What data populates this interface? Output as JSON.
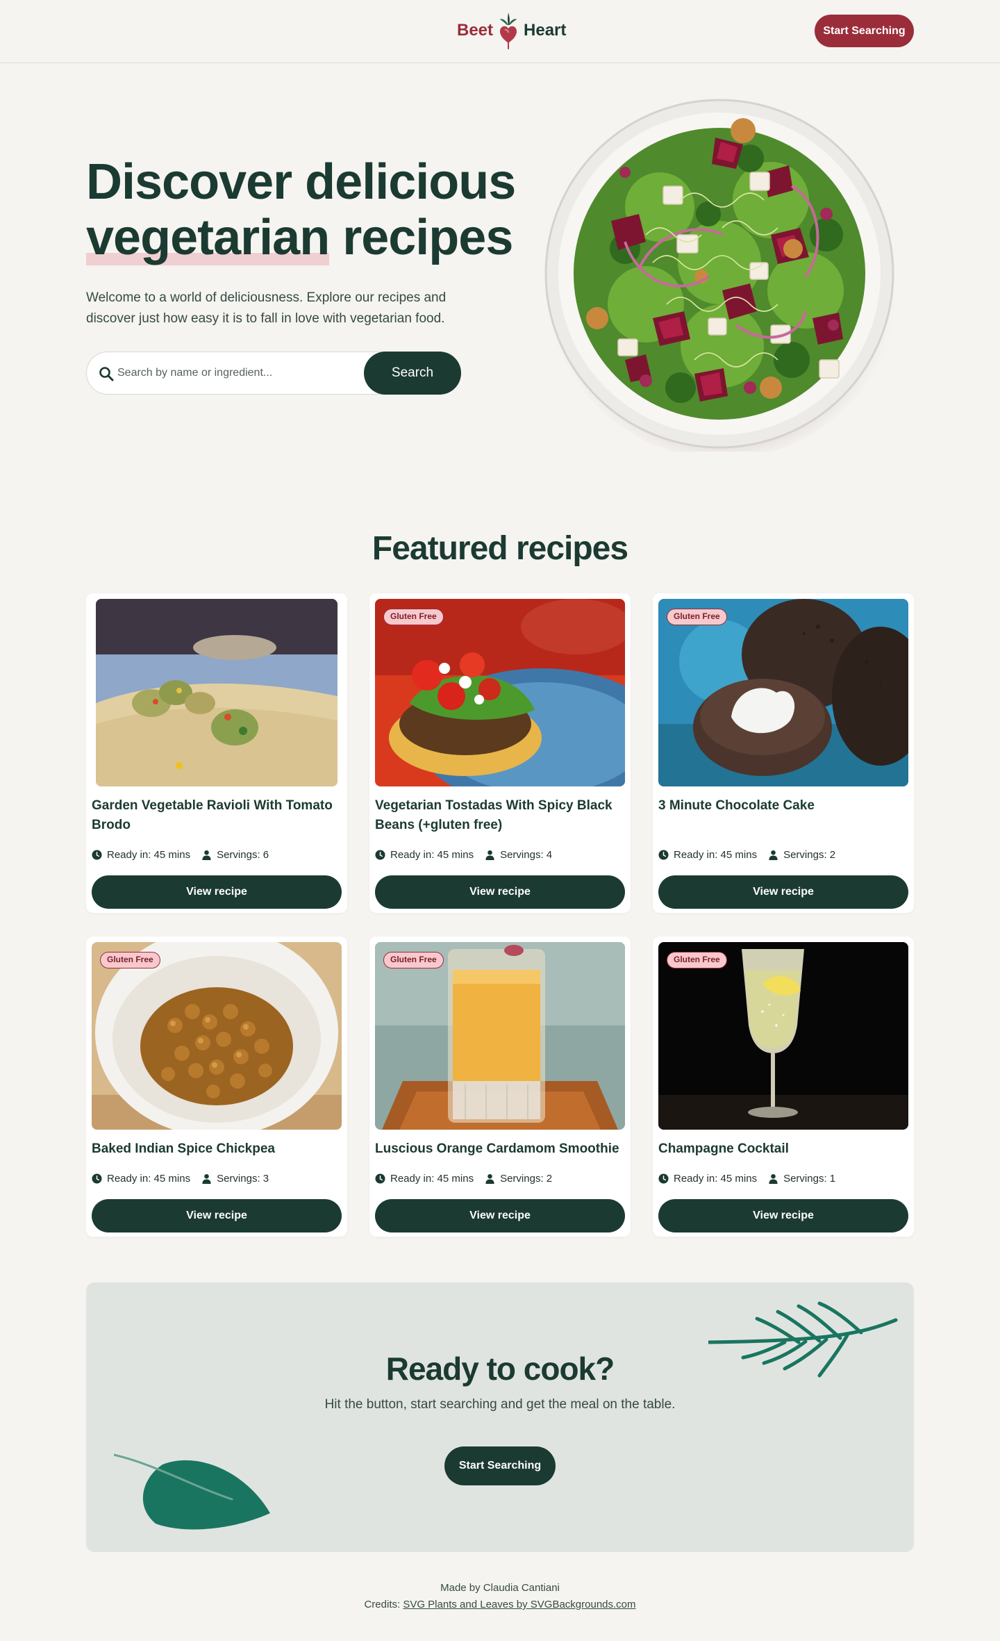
{
  "header": {
    "logo_left": "Beet",
    "logo_right": "Heart",
    "cta_label": "Start Searching"
  },
  "hero": {
    "title_line1": "Discover delicious",
    "title_highlight": "vegetarian",
    "title_rest": " recipes",
    "subtitle": "Welcome to a world of deliciousness. Explore our recipes and discover just how easy it is to fall in love with vegetarian food.",
    "search_placeholder": "Search by name or ingredient...",
    "search_value": "",
    "search_button": "Search"
  },
  "featured": {
    "title": "Featured recipes",
    "ready_prefix": "Ready in:",
    "servings_prefix": "Servings:",
    "view_label": "View recipe",
    "recipes": [
      {
        "title": "Garden Vegetable Ravioli With Tomato Brodo",
        "badge": "",
        "ready": "45 mins",
        "servings": "6"
      },
      {
        "title": "Vegetarian Tostadas With Spicy Black Beans (+gluten free)",
        "badge": "Gluten Free",
        "ready": "45 mins",
        "servings": "4"
      },
      {
        "title": "3 Minute Chocolate Cake",
        "badge": "Gluten Free",
        "ready": "45 mins",
        "servings": "2"
      },
      {
        "title": "Baked Indian Spice Chickpea",
        "badge": "Gluten Free",
        "ready": "45 mins",
        "servings": "3"
      },
      {
        "title": "Luscious Orange Cardamom Smoothie",
        "badge": "Gluten Free",
        "ready": "45 mins",
        "servings": "2"
      },
      {
        "title": "Champagne Cocktail",
        "badge": "Gluten Free",
        "ready": "45 mins",
        "servings": "1"
      }
    ]
  },
  "cta": {
    "title": "Ready to cook?",
    "subtitle": "Hit the button, start searching and get the meal on the table.",
    "button": "Start Searching"
  },
  "footer": {
    "made_by": "Made by Claudia Cantiani",
    "credits_prefix": "Credits:",
    "credits_link": "SVG Plants and Leaves by SVGBackgrounds.com"
  },
  "colors": {
    "background": "#f5f4f0",
    "primary_dark_green": "#1b3a32",
    "accent_beet": "#9b2d3a",
    "badge_pink": "#f7c9cd",
    "cta_panel": "#e0e4e1",
    "leaf_green": "#1a7560"
  },
  "icons": [
    "beet-heart-logo-icon",
    "search-icon",
    "clock-icon",
    "person-icon",
    "fern-decoration",
    "leaf-decoration"
  ]
}
